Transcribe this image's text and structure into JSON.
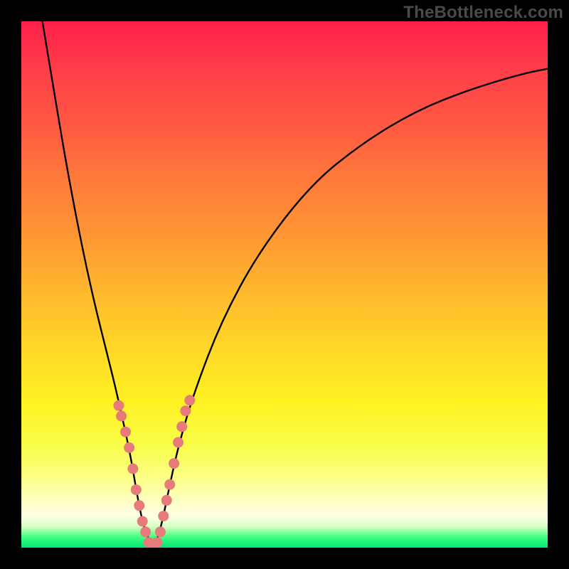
{
  "watermark": "TheBottleneck.com",
  "chart_data": {
    "type": "line",
    "title": "",
    "xlabel": "",
    "ylabel": "",
    "xlim": [
      0,
      100
    ],
    "ylim": [
      0,
      100
    ],
    "grid": false,
    "legend": false,
    "series": [
      {
        "name": "bottleneck-curve",
        "x": [
          4,
          6,
          8,
          10,
          12,
          14,
          16,
          18,
          20,
          21,
          22,
          23,
          24,
          25,
          26,
          27,
          28,
          30,
          33,
          38,
          45,
          55,
          65,
          75,
          85,
          95,
          100
        ],
        "y": [
          100,
          88,
          76,
          65,
          55,
          46,
          38,
          30,
          21,
          16,
          10,
          5,
          2,
          0,
          2,
          6,
          11,
          20,
          30,
          43,
          56,
          69,
          77,
          83,
          87,
          90,
          91
        ]
      }
    ],
    "markers": {
      "name": "highlight-dots",
      "color": "#e77b7b",
      "x": [
        18.5,
        19.0,
        19.8,
        20.5,
        21.2,
        21.8,
        22.4,
        23.0,
        23.6,
        24.2,
        25.0,
        25.8,
        26.4,
        27.0,
        27.6,
        28.2,
        29.0,
        29.8,
        30.5,
        31.2,
        32.0
      ],
      "y": [
        27,
        25,
        22,
        19,
        15,
        11,
        8,
        5,
        3,
        1,
        0,
        1,
        3,
        6,
        9,
        12,
        16,
        20,
        23,
        26,
        28
      ]
    }
  }
}
